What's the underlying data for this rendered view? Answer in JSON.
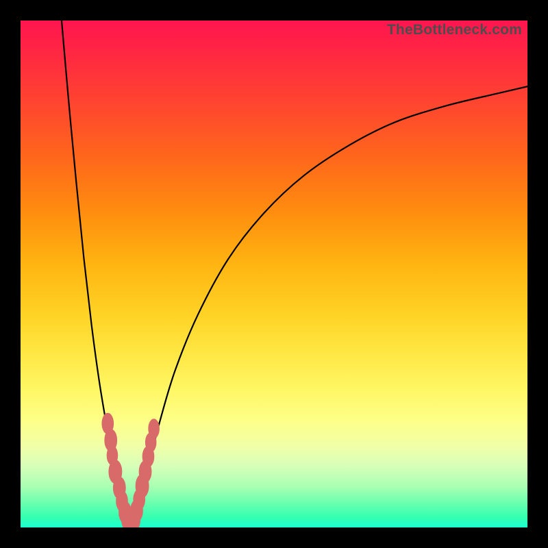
{
  "watermark": "TheBottleneck.com",
  "colors": {
    "frame": "#000000",
    "curve": "#000000",
    "blob": "#d86a69"
  },
  "chart_data": {
    "type": "line",
    "title": "",
    "xlabel": "",
    "ylabel": "",
    "xlim": [
      0,
      100
    ],
    "ylim": [
      0,
      100
    ],
    "grid": false,
    "note": "Axes are unlabeled; x/y are percentage of plot width/height with y=0 at bottom. Left curve descends from top-left toward the minimum; right curve rises from the minimum toward upper-right. Coral blobs mark data points clustered around the minimum.",
    "series": [
      {
        "name": "left-curve",
        "x": [
          8.1,
          9.5,
          11.0,
          12.5,
          14.0,
          15.5,
          17.0,
          18.0,
          18.8,
          19.6,
          20.2,
          20.7,
          21.1,
          21.5
        ],
        "y": [
          100.0,
          84.0,
          68.0,
          53.0,
          40.0,
          29.0,
          20.0,
          15.0,
          11.0,
          8.0,
          5.5,
          3.5,
          2.0,
          1.2
        ]
      },
      {
        "name": "right-curve",
        "x": [
          21.9,
          22.4,
          23.2,
          24.2,
          25.5,
          27.5,
          30.5,
          35.0,
          41.0,
          48.0,
          56.0,
          65.0,
          74.0,
          84.0,
          94.0,
          100.0
        ],
        "y": [
          1.0,
          2.2,
          4.5,
          8.0,
          13.0,
          21.0,
          31.0,
          42.0,
          53.0,
          62.0,
          69.5,
          75.5,
          80.0,
          83.2,
          85.6,
          87.0
        ]
      }
    ],
    "highlight_points": [
      {
        "x": 17.2,
        "y": 20.5,
        "r": 1.5
      },
      {
        "x": 17.8,
        "y": 17.2,
        "r": 1.6
      },
      {
        "x": 18.1,
        "y": 14.2,
        "r": 1.4
      },
      {
        "x": 18.7,
        "y": 11.0,
        "r": 1.7
      },
      {
        "x": 19.5,
        "y": 7.8,
        "r": 1.6
      },
      {
        "x": 20.0,
        "y": 5.2,
        "r": 1.5
      },
      {
        "x": 20.6,
        "y": 3.0,
        "r": 1.6
      },
      {
        "x": 21.2,
        "y": 1.6,
        "r": 1.7
      },
      {
        "x": 21.8,
        "y": 1.0,
        "r": 1.8
      },
      {
        "x": 22.3,
        "y": 1.5,
        "r": 1.7
      },
      {
        "x": 22.9,
        "y": 3.3,
        "r": 1.6
      },
      {
        "x": 23.4,
        "y": 5.5,
        "r": 1.5
      },
      {
        "x": 24.0,
        "y": 8.2,
        "r": 1.7
      },
      {
        "x": 24.6,
        "y": 11.0,
        "r": 1.6
      },
      {
        "x": 25.2,
        "y": 14.0,
        "r": 1.5
      },
      {
        "x": 25.7,
        "y": 16.8,
        "r": 1.4
      },
      {
        "x": 26.3,
        "y": 19.5,
        "r": 1.4
      }
    ]
  }
}
